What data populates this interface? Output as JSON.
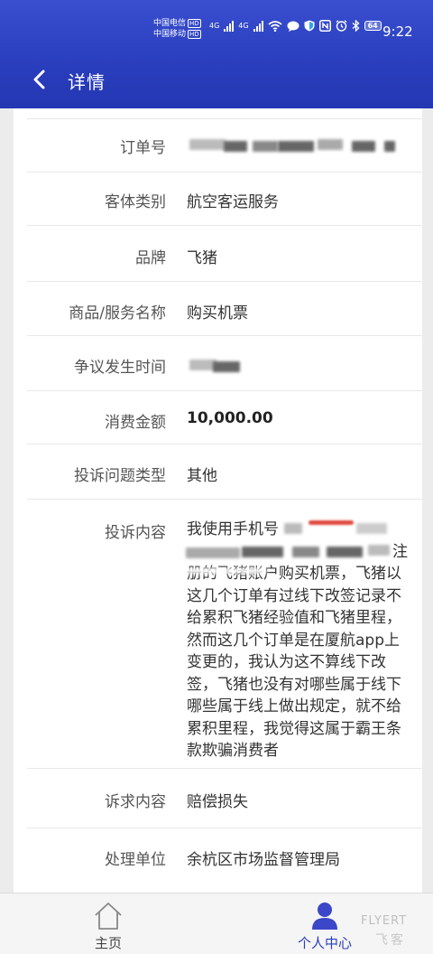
{
  "status_bar": {
    "carrier1": "中国电信",
    "carrier2": "中国移动",
    "hd": "HD",
    "net": "4G",
    "battery": "64",
    "time": "9:22"
  },
  "header": {
    "title": "详情"
  },
  "details": {
    "order_no": {
      "label": "订单号",
      "value": ""
    },
    "subject_type": {
      "label": "客体类别",
      "value": "航空客运服务"
    },
    "brand": {
      "label": "品牌",
      "value": "飞猪"
    },
    "product": {
      "label": "商品/服务名称",
      "value": "购买机票"
    },
    "dispute_time": {
      "label": "争议发生时间",
      "value": ""
    },
    "amount": {
      "label": "消费金额",
      "value": "10,000.00"
    },
    "issue_type": {
      "label": "投诉问题类型",
      "value": "其他"
    },
    "content": {
      "label": "投诉内容",
      "line1": "我使用手机号",
      "line2": "注",
      "line3": "册的飞猪账户购买机票，飞猪以",
      "line4": "这几个订单有过线下改签记录不",
      "line5": "给累积飞猪经验值和飞猪里程，",
      "line6": "然而这几个订单是在厦航app上",
      "line7": "变更的，我认为这不算线下改",
      "line8": "签，飞猪也没有对哪些属于线下",
      "line9": "哪些属于线上做出规定，就不给",
      "line10": "累积里程，我觉得这属于霸王条",
      "line11": "款欺骗消费者"
    },
    "demand": {
      "label": "诉求内容",
      "value": "赔偿损失"
    },
    "handler": {
      "label": "处理单位",
      "value": "余杭区市场监督管理局"
    }
  },
  "nav": {
    "home": "主页",
    "me": "个人中心"
  },
  "watermark": {
    "line1": "FLYERT",
    "line2": "飞客"
  },
  "colors": {
    "header": "#2a3fbf",
    "accent": "#3c46c8"
  }
}
